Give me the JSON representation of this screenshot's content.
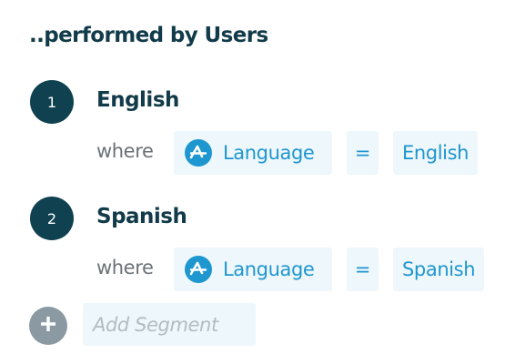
{
  "heading": "..performed by Users",
  "segments": [
    {
      "number": "1",
      "name": "English",
      "where_label": "where",
      "property_icon": "amplitude-logo-icon",
      "property": "Language",
      "operator": "=",
      "value": "English"
    },
    {
      "number": "2",
      "name": "Spanish",
      "where_label": "where",
      "property_icon": "amplitude-logo-icon",
      "property": "Language",
      "operator": "=",
      "value": "Spanish"
    }
  ],
  "add_segment": {
    "icon": "plus-icon",
    "label": "Add Segment"
  },
  "colors": {
    "primary_text": "#123b4a",
    "badge": "#0f4150",
    "accent": "#1e96cf",
    "chip_background": "#eef7fb",
    "muted": "#8a99a2",
    "placeholder": "#b3bcc1"
  }
}
